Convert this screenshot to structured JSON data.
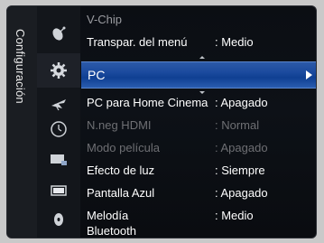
{
  "category": {
    "label": "Configuración"
  },
  "icons": [
    {
      "name": "satellite-icon"
    },
    {
      "name": "gear-icon"
    },
    {
      "name": "antenna-icon"
    },
    {
      "name": "clock-icon"
    },
    {
      "name": "tv-input-icon"
    },
    {
      "name": "screen-icon"
    },
    {
      "name": "disc-icon"
    }
  ],
  "menu": {
    "header": "V-Chip",
    "selected": {
      "label": "PC"
    },
    "items": [
      {
        "label": "Transpar. del menú",
        "value": ": Medio",
        "enabled": true
      },
      {
        "label": "PC para Home Cinema",
        "value": ": Apagado",
        "enabled": true
      },
      {
        "label": "N.neg HDMI",
        "value": ": Normal",
        "enabled": false
      },
      {
        "label": "Modo película",
        "value": ": Apagado",
        "enabled": false
      },
      {
        "label": "Efecto de luz",
        "value": ": Siempre",
        "enabled": true
      },
      {
        "label": "Pantalla Azul",
        "value": ": Apagado",
        "enabled": true
      },
      {
        "label": "Melodía",
        "value": ": Medio",
        "enabled": true
      },
      {
        "label": "Bluetooth",
        "value": "",
        "enabled": true
      }
    ]
  },
  "colors": {
    "selection": "#1b4a9e",
    "text": "#ffffff",
    "disabled_text": "#6e6f73"
  }
}
